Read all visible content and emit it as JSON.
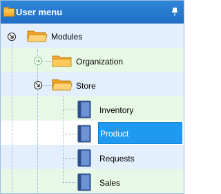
{
  "header": {
    "title": "User menu",
    "icon": "folder-icon",
    "pin_icon": "pin-icon"
  },
  "tree": {
    "modules": {
      "label": "Modules",
      "state": "expanded"
    },
    "organization": {
      "label": "Organization",
      "state": "collapsed"
    },
    "store": {
      "label": "Store",
      "state": "expanded"
    },
    "items": [
      {
        "label": "Inventory"
      },
      {
        "label": "Product",
        "selected": true
      },
      {
        "label": "Requests"
      },
      {
        "label": "Sales"
      }
    ]
  },
  "colors": {
    "header": "#2278cc",
    "selection": "#1e9bf0",
    "row_blue": "#e3effc",
    "row_green": "#e8f8e6"
  }
}
